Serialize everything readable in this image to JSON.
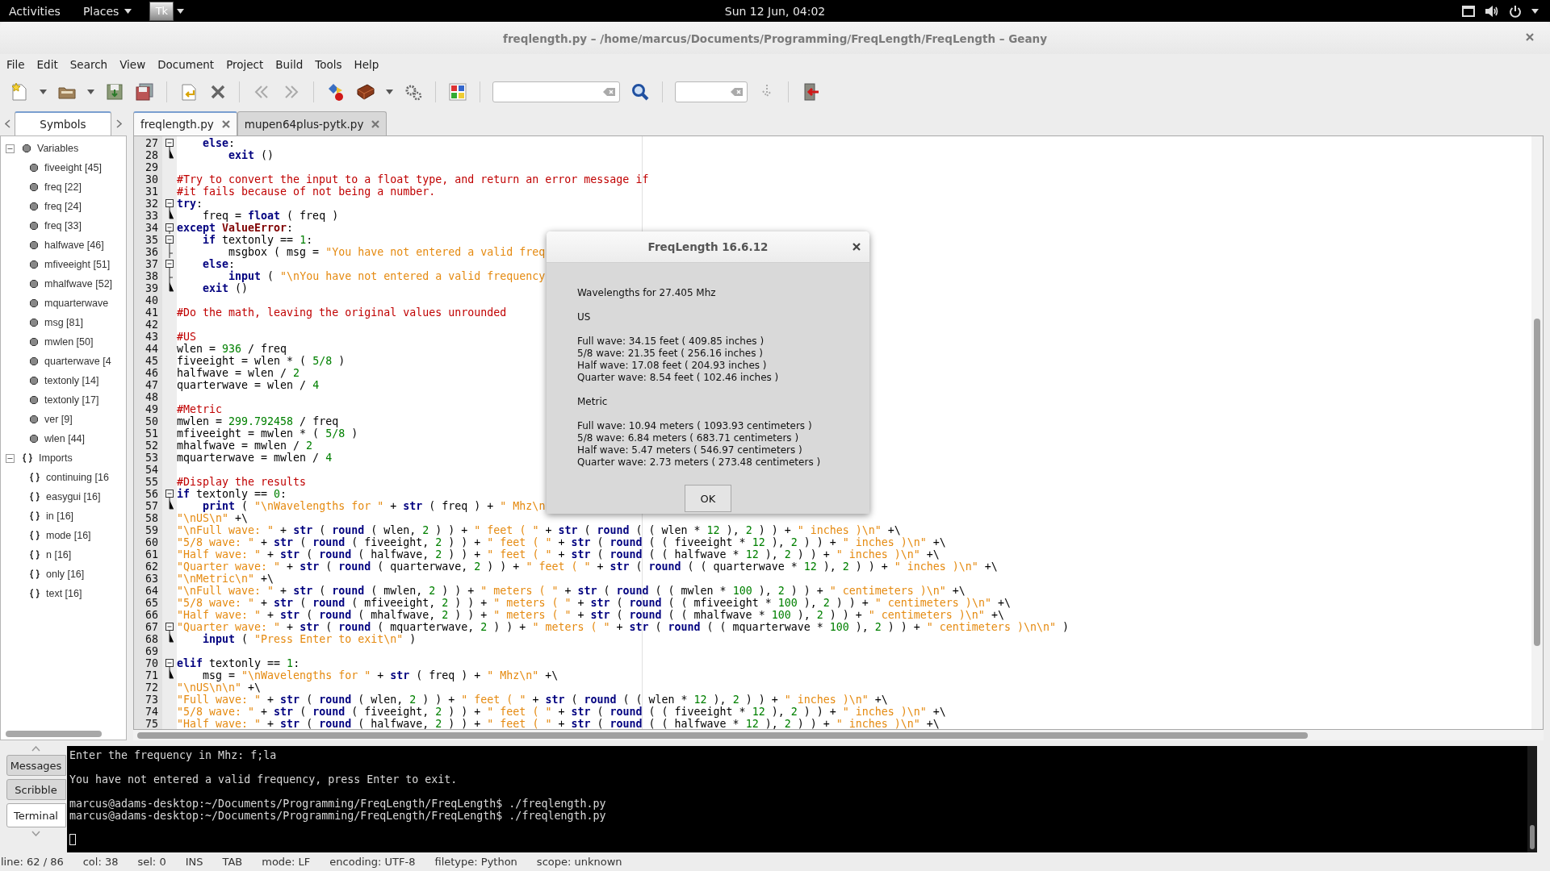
{
  "top_bar": {
    "activities": "Activities",
    "places": "Places",
    "app": "Tk",
    "clock": "Sun 12 Jun, 04:02"
  },
  "window": {
    "title": "freqlength.py – /home/marcus/Documents/Programming/FreqLength/FreqLength – Geany"
  },
  "menu": [
    "File",
    "Edit",
    "Search",
    "View",
    "Document",
    "Project",
    "Build",
    "Tools",
    "Help"
  ],
  "sidebar_tabs": [
    {
      "label": "Symbols",
      "selected": true
    }
  ],
  "symbols": [
    {
      "label": "Variables",
      "kind": "variables",
      "expanded": true,
      "children": [
        {
          "label": "fiveeight [45]"
        },
        {
          "label": "freq [22]"
        },
        {
          "label": "freq [24]"
        },
        {
          "label": "freq [33]"
        },
        {
          "label": "halfwave [46]"
        },
        {
          "label": "mfiveeight [51]"
        },
        {
          "label": "mhalfwave [52]"
        },
        {
          "label": "mquarterwave"
        },
        {
          "label": "msg [81]"
        },
        {
          "label": "mwlen [50]"
        },
        {
          "label": "quarterwave [4"
        },
        {
          "label": "textonly [14]"
        },
        {
          "label": "textonly [17]"
        },
        {
          "label": "ver [9]"
        },
        {
          "label": "wlen [44]"
        }
      ]
    },
    {
      "label": "Imports",
      "kind": "imports",
      "expanded": true,
      "children": [
        {
          "label": "continuing [16"
        },
        {
          "label": "easygui [16]"
        },
        {
          "label": "in [16]"
        },
        {
          "label": "mode [16]"
        },
        {
          "label": "n [16]"
        },
        {
          "label": "only [16]"
        },
        {
          "label": "text [16]"
        }
      ]
    }
  ],
  "editor_tabs": [
    {
      "label": "freqlength.py",
      "selected": true
    },
    {
      "label": "mupen64plus-pytk.py",
      "selected": false
    }
  ],
  "code_lines": [
    {
      "number": "27",
      "kind": "fold-start",
      "tokens": [
        {
          "kind": "keyword",
          "text": "    else"
        },
        {
          "kind": "plain",
          "text": ":"
        }
      ]
    },
    {
      "number": "28",
      "kind": "fold-end",
      "tokens": [
        {
          "kind": "keyword",
          "text": "        exit"
        },
        {
          "kind": "plain",
          "text": " ()"
        }
      ]
    },
    {
      "number": "29",
      "kind": "plain"
    },
    {
      "number": "30",
      "kind": "plain",
      "tokens": [
        {
          "kind": "comment",
          "text": "#Try to convert the input to a float type, and return an error message if"
        }
      ]
    },
    {
      "number": "31",
      "kind": "plain",
      "tokens": [
        {
          "kind": "comment",
          "text": "#it fails because of not being a number."
        }
      ]
    },
    {
      "number": "32",
      "kind": "fold-start",
      "tokens": [
        {
          "kind": "keyword",
          "text": "try"
        },
        {
          "kind": "plain",
          "text": ":"
        }
      ]
    },
    {
      "number": "33",
      "kind": "fold-end",
      "tokens": [
        {
          "kind": "plain",
          "text": "    freq = "
        },
        {
          "kind": "keyword",
          "text": "float"
        },
        {
          "kind": "plain",
          "text": " ( freq )"
        }
      ]
    },
    {
      "number": "34",
      "kind": "fold-start",
      "tokens": [
        {
          "kind": "keyword",
          "text": "except"
        },
        {
          "kind": "class",
          "text": " ValueError"
        },
        {
          "kind": "plain",
          "text": ":"
        }
      ]
    },
    {
      "number": "35",
      "kind": "fold-start",
      "tokens": [
        {
          "kind": "keyword",
          "text": "    if"
        },
        {
          "kind": "plain",
          "text": " textonly == "
        },
        {
          "kind": "number",
          "text": "1"
        },
        {
          "kind": "plain",
          "text": ":"
        }
      ]
    },
    {
      "number": "36",
      "kind": "fold-middle",
      "tokens": [
        {
          "kind": "plain",
          "text": "        msgbox ( msg = "
        },
        {
          "kind": "string",
          "text": "\"You have not entered a valid freq"
        }
      ]
    },
    {
      "number": "37",
      "kind": "fold-start",
      "tokens": [
        {
          "kind": "keyword",
          "text": "    else"
        },
        {
          "kind": "plain",
          "text": ":"
        }
      ]
    },
    {
      "number": "38",
      "kind": "fold-middle",
      "tokens": [
        {
          "kind": "keyword",
          "text": "        input"
        },
        {
          "kind": "plain",
          "text": " ( "
        },
        {
          "kind": "string",
          "text": "\"\\nYou have not entered a valid frequency"
        }
      ]
    },
    {
      "number": "39",
      "kind": "fold-end",
      "tokens": [
        {
          "kind": "keyword",
          "text": "    exit"
        },
        {
          "kind": "plain",
          "text": " ()"
        }
      ]
    },
    {
      "number": "40",
      "kind": "plain"
    },
    {
      "number": "41",
      "kind": "plain",
      "tokens": [
        {
          "kind": "comment",
          "text": "#Do the math, leaving the original values unrounded"
        }
      ]
    },
    {
      "number": "42",
      "kind": "plain"
    },
    {
      "number": "43",
      "kind": "plain",
      "tokens": [
        {
          "kind": "comment",
          "text": "#US"
        }
      ]
    },
    {
      "number": "44",
      "kind": "plain",
      "tokens": [
        {
          "kind": "plain",
          "text": "wlen = "
        },
        {
          "kind": "number",
          "text": "936"
        },
        {
          "kind": "plain",
          "text": " / freq"
        }
      ]
    },
    {
      "number": "45",
      "kind": "plain",
      "tokens": [
        {
          "kind": "plain",
          "text": "fiveeight = wlen * ( "
        },
        {
          "kind": "number",
          "text": "5/8"
        },
        {
          "kind": "plain",
          "text": " )"
        }
      ]
    },
    {
      "number": "46",
      "kind": "plain",
      "tokens": [
        {
          "kind": "plain",
          "text": "halfwave = wlen / "
        },
        {
          "kind": "number",
          "text": "2"
        }
      ]
    },
    {
      "number": "47",
      "kind": "plain",
      "tokens": [
        {
          "kind": "plain",
          "text": "quarterwave = wlen / "
        },
        {
          "kind": "number",
          "text": "4"
        }
      ]
    },
    {
      "number": "48",
      "kind": "plain"
    },
    {
      "number": "49",
      "kind": "plain",
      "tokens": [
        {
          "kind": "comment",
          "text": "#Metric"
        }
      ]
    },
    {
      "number": "50",
      "kind": "plain",
      "tokens": [
        {
          "kind": "plain",
          "text": "mwlen = "
        },
        {
          "kind": "number",
          "text": "299.792458"
        },
        {
          "kind": "plain",
          "text": " / freq"
        }
      ]
    },
    {
      "number": "51",
      "kind": "plain",
      "tokens": [
        {
          "kind": "plain",
          "text": "mfiveeight = mwlen * ( "
        },
        {
          "kind": "number",
          "text": "5/8"
        },
        {
          "kind": "plain",
          "text": " )"
        }
      ]
    },
    {
      "number": "52",
      "kind": "plain",
      "tokens": [
        {
          "kind": "plain",
          "text": "mhalfwave = mwlen / "
        },
        {
          "kind": "number",
          "text": "2"
        }
      ]
    },
    {
      "number": "53",
      "kind": "plain",
      "tokens": [
        {
          "kind": "plain",
          "text": "mquarterwave = mwlen / "
        },
        {
          "kind": "number",
          "text": "4"
        }
      ]
    },
    {
      "number": "54",
      "kind": "plain"
    },
    {
      "number": "55",
      "kind": "plain",
      "tokens": [
        {
          "kind": "comment",
          "text": "#Display the results"
        }
      ]
    },
    {
      "number": "56",
      "kind": "fold-start",
      "tokens": [
        {
          "kind": "keyword",
          "text": "if"
        },
        {
          "kind": "plain",
          "text": " textonly == "
        },
        {
          "kind": "number",
          "text": "0"
        },
        {
          "kind": "plain",
          "text": ":"
        }
      ]
    },
    {
      "number": "57",
      "kind": "fold-end",
      "tokens": [
        {
          "kind": "keyword",
          "text": "    print"
        },
        {
          "kind": "plain",
          "text": " ( "
        },
        {
          "kind": "string",
          "text": "\"\\nWavelengths for \""
        },
        {
          "kind": "plain",
          "text": " + "
        },
        {
          "kind": "keyword",
          "text": "str"
        },
        {
          "kind": "plain",
          "text": " ( freq ) + "
        },
        {
          "kind": "string",
          "text": "\" Mhz\\n"
        }
      ]
    },
    {
      "number": "58",
      "kind": "plain",
      "tokens": [
        {
          "kind": "string",
          "text": "\"\\nUS\\n\""
        },
        {
          "kind": "plain",
          "text": " +\\"
        }
      ]
    },
    {
      "number": "59",
      "kind": "plain",
      "tokens": [
        {
          "kind": "string",
          "text": "\"\\nFull wave: \""
        },
        {
          "kind": "plain",
          "text": " + "
        },
        {
          "kind": "keyword",
          "text": "str"
        },
        {
          "kind": "plain",
          "text": " ( "
        },
        {
          "kind": "keyword",
          "text": "round"
        },
        {
          "kind": "plain",
          "text": " ( wlen, "
        },
        {
          "kind": "number",
          "text": "2"
        },
        {
          "kind": "plain",
          "text": " ) ) + "
        },
        {
          "kind": "string",
          "text": "\" feet ( \""
        },
        {
          "kind": "plain",
          "text": " + "
        },
        {
          "kind": "keyword",
          "text": "str"
        },
        {
          "kind": "plain",
          "text": " ( "
        },
        {
          "kind": "keyword",
          "text": "round"
        },
        {
          "kind": "plain",
          "text": " ( ( wlen * "
        },
        {
          "kind": "number",
          "text": "12"
        },
        {
          "kind": "plain",
          "text": " ), "
        },
        {
          "kind": "number",
          "text": "2"
        },
        {
          "kind": "plain",
          "text": " ) ) + "
        },
        {
          "kind": "string",
          "text": "\" inches )\\n\""
        },
        {
          "kind": "plain",
          "text": " +\\"
        }
      ]
    },
    {
      "number": "60",
      "kind": "plain",
      "tokens": [
        {
          "kind": "string",
          "text": "\"5/8 wave: \""
        },
        {
          "kind": "plain",
          "text": " + "
        },
        {
          "kind": "keyword",
          "text": "str"
        },
        {
          "kind": "plain",
          "text": " ( "
        },
        {
          "kind": "keyword",
          "text": "round"
        },
        {
          "kind": "plain",
          "text": " ( fiveeight, "
        },
        {
          "kind": "number",
          "text": "2"
        },
        {
          "kind": "plain",
          "text": " ) ) + "
        },
        {
          "kind": "string",
          "text": "\" feet ( \""
        },
        {
          "kind": "plain",
          "text": " + "
        },
        {
          "kind": "keyword",
          "text": "str"
        },
        {
          "kind": "plain",
          "text": " ( "
        },
        {
          "kind": "keyword",
          "text": "round"
        },
        {
          "kind": "plain",
          "text": " ( ( fiveeight * "
        },
        {
          "kind": "number",
          "text": "12"
        },
        {
          "kind": "plain",
          "text": " ), "
        },
        {
          "kind": "number",
          "text": "2"
        },
        {
          "kind": "plain",
          "text": " ) ) + "
        },
        {
          "kind": "string",
          "text": "\" inches )\\n\""
        },
        {
          "kind": "plain",
          "text": " +\\"
        }
      ]
    },
    {
      "number": "61",
      "kind": "plain",
      "tokens": [
        {
          "kind": "string",
          "text": "\"Half wave: \""
        },
        {
          "kind": "plain",
          "text": " + "
        },
        {
          "kind": "keyword",
          "text": "str"
        },
        {
          "kind": "plain",
          "text": " ( "
        },
        {
          "kind": "keyword",
          "text": "round"
        },
        {
          "kind": "plain",
          "text": " ( halfwave, "
        },
        {
          "kind": "number",
          "text": "2"
        },
        {
          "kind": "plain",
          "text": " ) ) + "
        },
        {
          "kind": "string",
          "text": "\" feet ( \""
        },
        {
          "kind": "plain",
          "text": " + "
        },
        {
          "kind": "keyword",
          "text": "str"
        },
        {
          "kind": "plain",
          "text": " ( "
        },
        {
          "kind": "keyword",
          "text": "round"
        },
        {
          "kind": "plain",
          "text": " ( ( halfwave * "
        },
        {
          "kind": "number",
          "text": "12"
        },
        {
          "kind": "plain",
          "text": " ), "
        },
        {
          "kind": "number",
          "text": "2"
        },
        {
          "kind": "plain",
          "text": " ) ) + "
        },
        {
          "kind": "string",
          "text": "\" inches )\\n\""
        },
        {
          "kind": "plain",
          "text": " +\\"
        }
      ]
    },
    {
      "number": "62",
      "kind": "plain",
      "tokens": [
        {
          "kind": "string",
          "text": "\"Quarter wave: \""
        },
        {
          "kind": "plain",
          "text": " + "
        },
        {
          "kind": "keyword",
          "text": "str"
        },
        {
          "kind": "plain",
          "text": " ( "
        },
        {
          "kind": "keyword",
          "text": "round"
        },
        {
          "kind": "plain",
          "text": " ( quarterwave, "
        },
        {
          "kind": "number",
          "text": "2"
        },
        {
          "kind": "plain",
          "text": " ) ) + "
        },
        {
          "kind": "string",
          "text": "\" feet ( \""
        },
        {
          "kind": "plain",
          "text": " + "
        },
        {
          "kind": "keyword",
          "text": "str"
        },
        {
          "kind": "plain",
          "text": " ( "
        },
        {
          "kind": "keyword",
          "text": "round"
        },
        {
          "kind": "plain",
          "text": " ( ( quarterwave * "
        },
        {
          "kind": "number",
          "text": "12"
        },
        {
          "kind": "plain",
          "text": " ), "
        },
        {
          "kind": "number",
          "text": "2"
        },
        {
          "kind": "plain",
          "text": " ) ) + "
        },
        {
          "kind": "string",
          "text": "\" inches )\\n\""
        },
        {
          "kind": "plain",
          "text": " +\\"
        }
      ]
    },
    {
      "number": "63",
      "kind": "plain",
      "tokens": [
        {
          "kind": "string",
          "text": "\"\\nMetric\\n\""
        },
        {
          "kind": "plain",
          "text": " +\\"
        }
      ]
    },
    {
      "number": "64",
      "kind": "plain",
      "tokens": [
        {
          "kind": "string",
          "text": "\"\\nFull wave: \""
        },
        {
          "kind": "plain",
          "text": " + "
        },
        {
          "kind": "keyword",
          "text": "str"
        },
        {
          "kind": "plain",
          "text": " ( "
        },
        {
          "kind": "keyword",
          "text": "round"
        },
        {
          "kind": "plain",
          "text": " ( mwlen, "
        },
        {
          "kind": "number",
          "text": "2"
        },
        {
          "kind": "plain",
          "text": " ) ) + "
        },
        {
          "kind": "string",
          "text": "\" meters ( \""
        },
        {
          "kind": "plain",
          "text": " + "
        },
        {
          "kind": "keyword",
          "text": "str"
        },
        {
          "kind": "plain",
          "text": " ( "
        },
        {
          "kind": "keyword",
          "text": "round"
        },
        {
          "kind": "plain",
          "text": " ( ( mwlen * "
        },
        {
          "kind": "number",
          "text": "100"
        },
        {
          "kind": "plain",
          "text": " ), "
        },
        {
          "kind": "number",
          "text": "2"
        },
        {
          "kind": "plain",
          "text": " ) ) + "
        },
        {
          "kind": "string",
          "text": "\" centimeters )\\n\""
        },
        {
          "kind": "plain",
          "text": " +\\"
        }
      ]
    },
    {
      "number": "65",
      "kind": "plain",
      "tokens": [
        {
          "kind": "string",
          "text": "\"5/8 wave: \""
        },
        {
          "kind": "plain",
          "text": " + "
        },
        {
          "kind": "keyword",
          "text": "str"
        },
        {
          "kind": "plain",
          "text": " ( "
        },
        {
          "kind": "keyword",
          "text": "round"
        },
        {
          "kind": "plain",
          "text": " ( mfiveeight, "
        },
        {
          "kind": "number",
          "text": "2"
        },
        {
          "kind": "plain",
          "text": " ) ) + "
        },
        {
          "kind": "string",
          "text": "\" meters ( \""
        },
        {
          "kind": "plain",
          "text": " + "
        },
        {
          "kind": "keyword",
          "text": "str"
        },
        {
          "kind": "plain",
          "text": " ( "
        },
        {
          "kind": "keyword",
          "text": "round"
        },
        {
          "kind": "plain",
          "text": " ( ( mfiveeight * "
        },
        {
          "kind": "number",
          "text": "100"
        },
        {
          "kind": "plain",
          "text": " ), "
        },
        {
          "kind": "number",
          "text": "2"
        },
        {
          "kind": "plain",
          "text": " ) ) + "
        },
        {
          "kind": "string",
          "text": "\" centimeters )\\n\""
        },
        {
          "kind": "plain",
          "text": " +\\"
        }
      ]
    },
    {
      "number": "66",
      "kind": "plain",
      "tokens": [
        {
          "kind": "string",
          "text": "\"Half wave: \""
        },
        {
          "kind": "plain",
          "text": " + "
        },
        {
          "kind": "keyword",
          "text": "str"
        },
        {
          "kind": "plain",
          "text": " ( "
        },
        {
          "kind": "keyword",
          "text": "round"
        },
        {
          "kind": "plain",
          "text": " ( mhalfwave, "
        },
        {
          "kind": "number",
          "text": "2"
        },
        {
          "kind": "plain",
          "text": " ) ) + "
        },
        {
          "kind": "string",
          "text": "\" meters ( \""
        },
        {
          "kind": "plain",
          "text": " + "
        },
        {
          "kind": "keyword",
          "text": "str"
        },
        {
          "kind": "plain",
          "text": " ( "
        },
        {
          "kind": "keyword",
          "text": "round"
        },
        {
          "kind": "plain",
          "text": " ( ( mhalfwave * "
        },
        {
          "kind": "number",
          "text": "100"
        },
        {
          "kind": "plain",
          "text": " ), "
        },
        {
          "kind": "number",
          "text": "2"
        },
        {
          "kind": "plain",
          "text": " ) ) + "
        },
        {
          "kind": "string",
          "text": "\" centimeters )\\n\""
        },
        {
          "kind": "plain",
          "text": " +\\"
        }
      ]
    },
    {
      "number": "67",
      "kind": "fold-start",
      "tokens": [
        {
          "kind": "string",
          "text": "\"Quarter wave: \""
        },
        {
          "kind": "plain",
          "text": " + "
        },
        {
          "kind": "keyword",
          "text": "str"
        },
        {
          "kind": "plain",
          "text": " ( "
        },
        {
          "kind": "keyword",
          "text": "round"
        },
        {
          "kind": "plain",
          "text": " ( mquarterwave, "
        },
        {
          "kind": "number",
          "text": "2"
        },
        {
          "kind": "plain",
          "text": " ) ) + "
        },
        {
          "kind": "string",
          "text": "\" meters ( \""
        },
        {
          "kind": "plain",
          "text": " + "
        },
        {
          "kind": "keyword",
          "text": "str"
        },
        {
          "kind": "plain",
          "text": " ( "
        },
        {
          "kind": "keyword",
          "text": "round"
        },
        {
          "kind": "plain",
          "text": " ( ( mquarterwave * "
        },
        {
          "kind": "number",
          "text": "100"
        },
        {
          "kind": "plain",
          "text": " ), "
        },
        {
          "kind": "number",
          "text": "2"
        },
        {
          "kind": "plain",
          "text": " ) ) + "
        },
        {
          "kind": "string",
          "text": "\" centimeters )\\n\\n\""
        },
        {
          "kind": "plain",
          "text": " )"
        }
      ]
    },
    {
      "number": "68",
      "kind": "fold-end",
      "tokens": [
        {
          "kind": "keyword",
          "text": "    input"
        },
        {
          "kind": "plain",
          "text": " ( "
        },
        {
          "kind": "string",
          "text": "\"Press Enter to exit\\n\""
        },
        {
          "kind": "plain",
          "text": " )"
        }
      ]
    },
    {
      "number": "69",
      "kind": "plain"
    },
    {
      "number": "70",
      "kind": "fold-start",
      "tokens": [
        {
          "kind": "keyword",
          "text": "elif"
        },
        {
          "kind": "plain",
          "text": " textonly == "
        },
        {
          "kind": "number",
          "text": "1"
        },
        {
          "kind": "plain",
          "text": ":"
        }
      ]
    },
    {
      "number": "71",
      "kind": "fold-end",
      "tokens": [
        {
          "kind": "plain",
          "text": "    msg = "
        },
        {
          "kind": "string",
          "text": "\"\\nWavelengths for \""
        },
        {
          "kind": "plain",
          "text": " + "
        },
        {
          "kind": "keyword",
          "text": "str"
        },
        {
          "kind": "plain",
          "text": " ( freq ) + "
        },
        {
          "kind": "string",
          "text": "\" Mhz\\n\""
        },
        {
          "kind": "plain",
          "text": " +\\"
        }
      ]
    },
    {
      "number": "72",
      "kind": "plain",
      "tokens": [
        {
          "kind": "string",
          "text": "\"\\nUS\\n\\n\""
        },
        {
          "kind": "plain",
          "text": " +\\"
        }
      ]
    },
    {
      "number": "73",
      "kind": "plain",
      "tokens": [
        {
          "kind": "string",
          "text": "\"Full wave: \""
        },
        {
          "kind": "plain",
          "text": " + "
        },
        {
          "kind": "keyword",
          "text": "str"
        },
        {
          "kind": "plain",
          "text": " ( "
        },
        {
          "kind": "keyword",
          "text": "round"
        },
        {
          "kind": "plain",
          "text": " ( wlen, "
        },
        {
          "kind": "number",
          "text": "2"
        },
        {
          "kind": "plain",
          "text": " ) ) + "
        },
        {
          "kind": "string",
          "text": "\" feet ( \""
        },
        {
          "kind": "plain",
          "text": " + "
        },
        {
          "kind": "keyword",
          "text": "str"
        },
        {
          "kind": "plain",
          "text": " ( "
        },
        {
          "kind": "keyword",
          "text": "round"
        },
        {
          "kind": "plain",
          "text": " ( ( wlen * "
        },
        {
          "kind": "number",
          "text": "12"
        },
        {
          "kind": "plain",
          "text": " ), "
        },
        {
          "kind": "number",
          "text": "2"
        },
        {
          "kind": "plain",
          "text": " ) ) + "
        },
        {
          "kind": "string",
          "text": "\" inches )\\n\""
        },
        {
          "kind": "plain",
          "text": " +\\"
        }
      ]
    },
    {
      "number": "74",
      "kind": "plain",
      "tokens": [
        {
          "kind": "string",
          "text": "\"5/8 wave: \""
        },
        {
          "kind": "plain",
          "text": " + "
        },
        {
          "kind": "keyword",
          "text": "str"
        },
        {
          "kind": "plain",
          "text": " ( "
        },
        {
          "kind": "keyword",
          "text": "round"
        },
        {
          "kind": "plain",
          "text": " ( fiveeight, "
        },
        {
          "kind": "number",
          "text": "2"
        },
        {
          "kind": "plain",
          "text": " ) ) + "
        },
        {
          "kind": "string",
          "text": "\" feet ( \""
        },
        {
          "kind": "plain",
          "text": " + "
        },
        {
          "kind": "keyword",
          "text": "str"
        },
        {
          "kind": "plain",
          "text": " ( "
        },
        {
          "kind": "keyword",
          "text": "round"
        },
        {
          "kind": "plain",
          "text": " ( ( fiveeight * "
        },
        {
          "kind": "number",
          "text": "12"
        },
        {
          "kind": "plain",
          "text": " ), "
        },
        {
          "kind": "number",
          "text": "2"
        },
        {
          "kind": "plain",
          "text": " ) ) + "
        },
        {
          "kind": "string",
          "text": "\" inches )\\n\""
        },
        {
          "kind": "plain",
          "text": " +\\"
        }
      ]
    },
    {
      "number": "75",
      "kind": "plain",
      "tokens": [
        {
          "kind": "string",
          "text": "\"Half wave: \""
        },
        {
          "kind": "plain",
          "text": " + "
        },
        {
          "kind": "keyword",
          "text": "str"
        },
        {
          "kind": "plain",
          "text": " ( "
        },
        {
          "kind": "keyword",
          "text": "round"
        },
        {
          "kind": "plain",
          "text": " ( halfwave, "
        },
        {
          "kind": "number",
          "text": "2"
        },
        {
          "kind": "plain",
          "text": " ) ) + "
        },
        {
          "kind": "string",
          "text": "\" feet ( \""
        },
        {
          "kind": "plain",
          "text": " + "
        },
        {
          "kind": "keyword",
          "text": "str"
        },
        {
          "kind": "plain",
          "text": " ( "
        },
        {
          "kind": "keyword",
          "text": "round"
        },
        {
          "kind": "plain",
          "text": " ( ( halfwave * "
        },
        {
          "kind": "number",
          "text": "12"
        },
        {
          "kind": "plain",
          "text": " ), "
        },
        {
          "kind": "number",
          "text": "2"
        },
        {
          "kind": "plain",
          "text": " ) ) + "
        },
        {
          "kind": "string",
          "text": "\" inches )\\n\""
        },
        {
          "kind": "plain",
          "text": " +\\"
        }
      ]
    }
  ],
  "dialog": {
    "title": "FreqLength 16.6.12",
    "paragraphs": [
      [
        "Wavelengths for 27.405 Mhz"
      ],
      [
        "US"
      ],
      [
        "Full wave: 34.15 feet ( 409.85 inches )",
        "5/8 wave: 21.35 feet ( 256.16 inches )",
        "Half wave: 17.08 feet ( 204.93 inches )",
        "Quarter wave: 8.54 feet ( 102.46 inches )"
      ],
      [
        "Metric"
      ],
      [
        "Full wave: 10.94 meters ( 1093.93 centimeters )",
        "5/8 wave: 6.84 meters ( 683.71 centimeters )",
        "Half wave: 5.47 meters ( 546.97 centimeters )",
        "Quarter wave: 2.73 meters ( 273.48 centimeters )"
      ]
    ],
    "button": "OK"
  },
  "bottom_panel": {
    "tabs": [
      {
        "label": "Messages",
        "selected": false
      },
      {
        "label": "Scribble",
        "selected": false
      },
      {
        "label": "Terminal",
        "selected": true
      }
    ],
    "terminal_blocks": [
      [
        "Enter the frequency in Mhz: f;la"
      ],
      [
        "You have not entered a valid frequency, press Enter to exit."
      ],
      [
        "marcus@adams-desktop:~/Documents/Programming/FreqLength/FreqLength$ ./freqlength.py",
        "marcus@adams-desktop:~/Documents/Programming/FreqLength/FreqLength$ ./freqlength.py"
      ]
    ]
  },
  "status_bar": [
    "line: 62 / 86",
    "col: 38",
    "sel: 0",
    "INS",
    "TAB",
    "mode: LF",
    "encoding: UTF-8",
    "filetype: Python",
    "scope: unknown"
  ]
}
